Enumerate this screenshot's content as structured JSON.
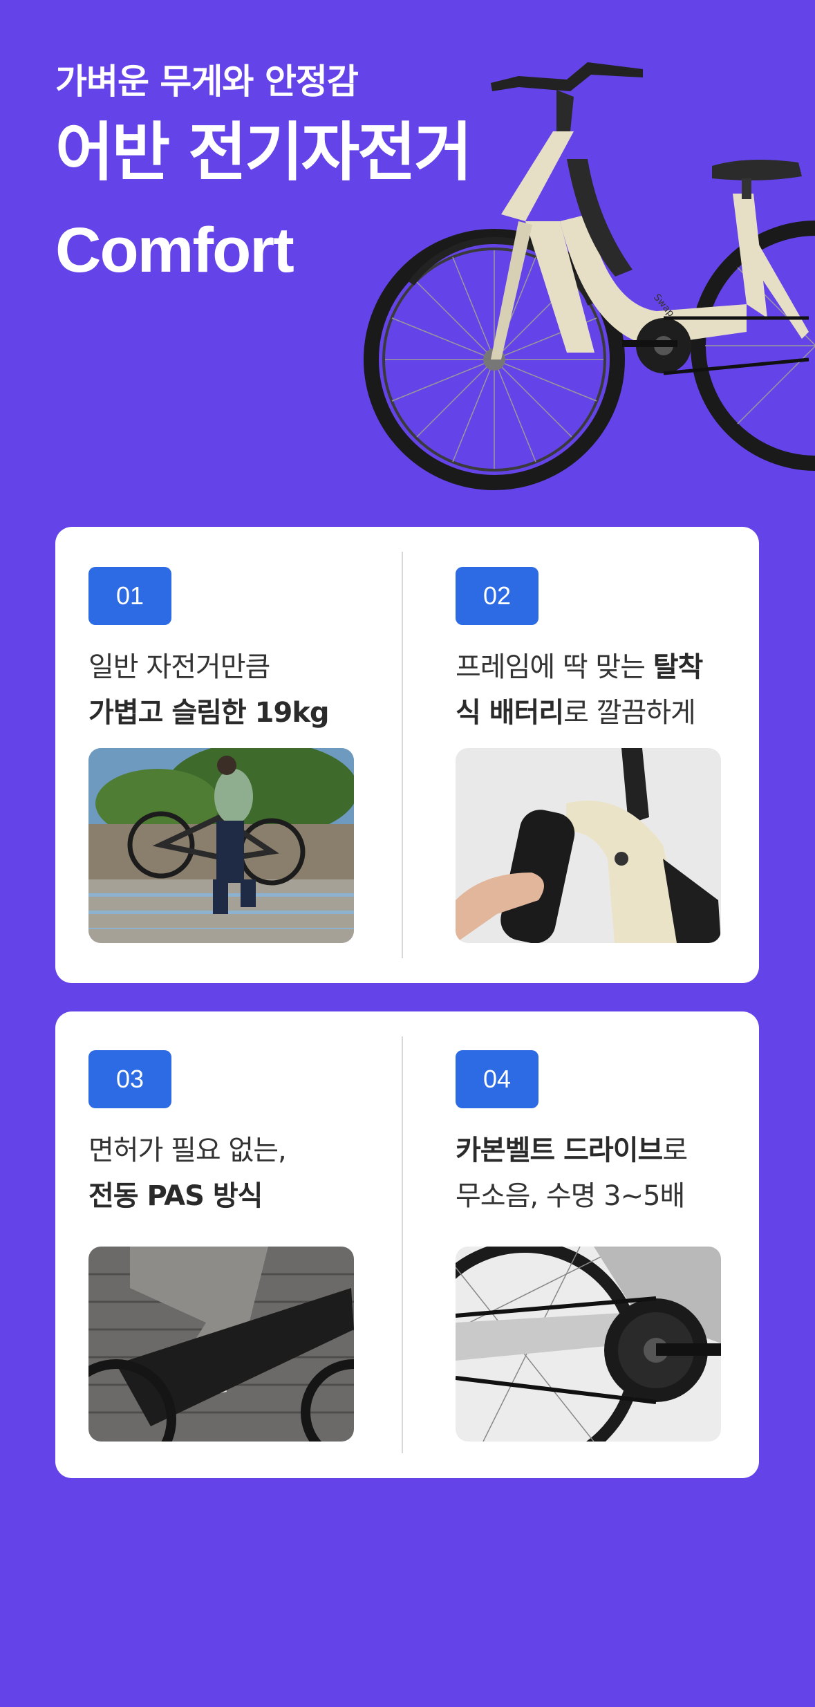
{
  "hero": {
    "subtitle": "가벼운 무게와 안정감",
    "title": "어반 전기자전거",
    "model": "Comfort",
    "bike_brand": "Swap"
  },
  "features": [
    {
      "badge": "01",
      "line1_normal": "일반 자전거만큼",
      "line1_bold": "",
      "line2_bold": "가볍고 슬림한 19kg",
      "line2_normal": "",
      "image": "man-carrying-bike-on-stairs"
    },
    {
      "badge": "02",
      "line1_normal": "프레임에 딱 맞는 ",
      "line1_bold": "탈착",
      "line2_bold": "식 배터리",
      "line2_normal": "로 깔끔하게",
      "image": "hand-removing-battery"
    },
    {
      "badge": "03",
      "line1_normal": "면허가 필요 없는,",
      "line1_bold": "",
      "line2_bold": "전동 PAS 방식",
      "line2_normal": "",
      "image": "rider-pedaling-closeup"
    },
    {
      "badge": "04",
      "line1_normal": "",
      "line1_bold": "카본벨트 드라이브",
      "line2_bold": "",
      "line2_normal": "로",
      "line3_normal": "무소음, 수명 3~5배",
      "image": "belt-drive-chainring"
    }
  ],
  "colors": {
    "background": "#6443e8",
    "badge": "#2d6be4",
    "card": "#ffffff",
    "bike_frame": "#e6dfc6"
  }
}
